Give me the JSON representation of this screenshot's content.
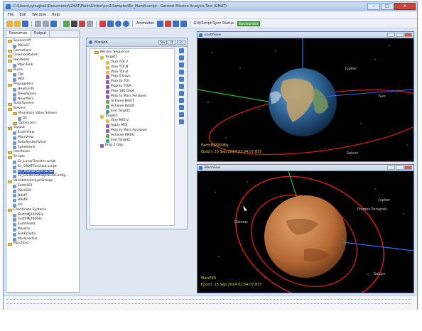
{
  "window": {
    "title": "C:\\Users\\syhughe1\\Documents\\GMAT\\Plain\\Git\\bin\\scr2\\Samples\\Ex_MarsB.script - General Mission Analysis Tool (GMAT)"
  },
  "menu": {
    "items": [
      "File",
      "Edit",
      "Window",
      "Help"
    ]
  },
  "toolbar": {
    "animation_label": "Animation",
    "gui_sync_label": "GUI/Script Sync Status:",
    "sync_status": "Synchronized"
  },
  "left_panel": {
    "tabs": [
      "Resources",
      "Output"
    ],
    "tree": [
      {
        "label": "Spacecraft",
        "type": "folder",
        "indent": 0
      },
      {
        "label": "MarsSC",
        "type": "item",
        "indent": 1
      },
      {
        "label": "Formations",
        "type": "folder",
        "indent": 0
      },
      {
        "label": "Ground Station",
        "type": "folder",
        "indent": 0
      },
      {
        "label": "Hardware",
        "type": "folder",
        "indent": 0
      },
      {
        "label": "MainTank",
        "type": "item",
        "indent": 1
      },
      {
        "label": "Burns",
        "type": "folder",
        "indent": 0
      },
      {
        "label": "TOI",
        "type": "item",
        "indent": 1
      },
      {
        "label": "MOI",
        "type": "item",
        "indent": 1
      },
      {
        "label": "Propagators",
        "type": "folder",
        "indent": 0
      },
      {
        "label": "NearEarth",
        "type": "item",
        "indent": 1
      },
      {
        "label": "DeepSpace",
        "type": "item",
        "indent": 1
      },
      {
        "label": "NearMars",
        "type": "item",
        "indent": 1
      },
      {
        "label": "SolarSystem",
        "type": "folder",
        "indent": 0
      },
      {
        "label": "Solvers",
        "type": "folder",
        "indent": 0
      },
      {
        "label": "Boundary Value Solvers",
        "type": "folder",
        "indent": 1
      },
      {
        "label": "DC",
        "type": "item",
        "indent": 2
      },
      {
        "label": "Optimizers",
        "type": "folder",
        "indent": 1
      },
      {
        "label": "Output",
        "type": "folder",
        "indent": 0
      },
      {
        "label": "EarthView",
        "type": "item",
        "indent": 1
      },
      {
        "label": "MarsView",
        "type": "item",
        "indent": 1
      },
      {
        "label": "SolarSystemView",
        "type": "item",
        "indent": 1
      },
      {
        "label": "Ephemeris",
        "type": "item",
        "indent": 1
      },
      {
        "label": "Interfaces",
        "type": "folder",
        "indent": 0
      },
      {
        "label": "Scripts",
        "type": "folder",
        "indent": 0
      },
      {
        "label": "Ex_LunarTransfer.script",
        "type": "item",
        "indent": 1
      },
      {
        "label": "Ex_GMATFunction.script",
        "type": "item",
        "indent": 1
      },
      {
        "label": "Ex_MarsBPlane.script",
        "type": "item",
        "indent": 1,
        "selected": true
      },
      {
        "label": "Ex_GoldenSatsBplanesConfig...",
        "type": "item",
        "indent": 1
      },
      {
        "label": "Variables/Arrays/Strings",
        "type": "folder",
        "indent": 0
      },
      {
        "label": "EarthSOI",
        "type": "item",
        "indent": 1
      },
      {
        "label": "MarsSOI",
        "type": "item",
        "indent": 1
      },
      {
        "label": "BdotT",
        "type": "item",
        "indent": 1
      },
      {
        "label": "BdotR",
        "type": "item",
        "indent": 1
      },
      {
        "label": "Inc",
        "type": "item",
        "indent": 1
      },
      {
        "label": "Coordinate Systems",
        "type": "folder",
        "indent": 0
      },
      {
        "label": "EarthMJ2000Eq",
        "type": "item",
        "indent": 1
      },
      {
        "label": "EarthMJ2000Ec",
        "type": "item",
        "indent": 1
      },
      {
        "label": "EarthFixed",
        "type": "item",
        "indent": 1
      },
      {
        "label": "MarsInc",
        "type": "item",
        "indent": 1
      },
      {
        "label": "SunEcliptic",
        "type": "item",
        "indent": 1
      },
      {
        "label": "MarsInertial",
        "type": "item",
        "indent": 1
      },
      {
        "label": "Functions",
        "type": "folder",
        "indent": 0
      }
    ]
  },
  "mission_panel": {
    "title": "Mission",
    "buttons": [
      "Sav",
      "Pt",
      "Ex"
    ],
    "tree": [
      {
        "label": "Mission Sequence",
        "indent": 0,
        "icon": "folder"
      },
      {
        "label": "Target1",
        "indent": 1,
        "icon": "y"
      },
      {
        "label": "Vary TOI.V",
        "indent": 2,
        "icon": "y"
      },
      {
        "label": "Vary TOI.N",
        "indent": 2,
        "icon": "y"
      },
      {
        "label": "Vary TOI.B",
        "indent": 2,
        "icon": "y"
      },
      {
        "label": "Prop 0 Days",
        "indent": 2,
        "icon": "p"
      },
      {
        "label": "Prop to TOI",
        "indent": 2,
        "icon": "p"
      },
      {
        "label": "Prop to TOIA",
        "indent": 2,
        "icon": "p"
      },
      {
        "label": "Prop 180 Days",
        "indent": 2,
        "icon": "p"
      },
      {
        "label": "Prop to Mars Periapsis",
        "indent": 2,
        "icon": "p"
      },
      {
        "label": "Achieve BdotT",
        "indent": 2,
        "icon": "g"
      },
      {
        "label": "Achieve BdotR",
        "indent": 2,
        "icon": "g"
      },
      {
        "label": "End Target1",
        "indent": 2,
        "icon": "t"
      },
      {
        "label": "Target2",
        "indent": 1,
        "icon": "y"
      },
      {
        "label": "Vary MOI.V",
        "indent": 2,
        "icon": "y"
      },
      {
        "label": "Apply MOI",
        "indent": 2,
        "icon": "p"
      },
      {
        "label": "Prop to Mars Apoapsis",
        "indent": 2,
        "icon": "p"
      },
      {
        "label": "Achieve RMAG",
        "indent": 2,
        "icon": "g"
      },
      {
        "label": "End Target2",
        "indent": 2,
        "icon": "t"
      },
      {
        "label": "Prop 1 Day",
        "indent": 1,
        "icon": "p"
      }
    ]
  },
  "earth_view": {
    "title": "EarthView",
    "labels": {
      "jupiter": "Jupiter",
      "sun": "Sun",
      "saturn": "Saturn"
    },
    "caption_line1": "EarthMJ2000Eq",
    "caption_line2": "Epoch: 23 Sep 2014 02:34:07.837"
  },
  "mars_view": {
    "title": "MarsView",
    "labels": {
      "jupiter": "Jupiter",
      "phobos": "Phobos Periapsis",
      "moon": "Deimos",
      "saturn": "Saturn"
    },
    "caption_line1": "MarsFK5",
    "caption_line2": "Epoch: 23 Sep 2014 02:34:07.837"
  },
  "colors": {
    "orbit": "#d41e1e",
    "x_axis": "#3a64ff",
    "y_axis": "#22c02a",
    "caption": "#f0d23a"
  }
}
